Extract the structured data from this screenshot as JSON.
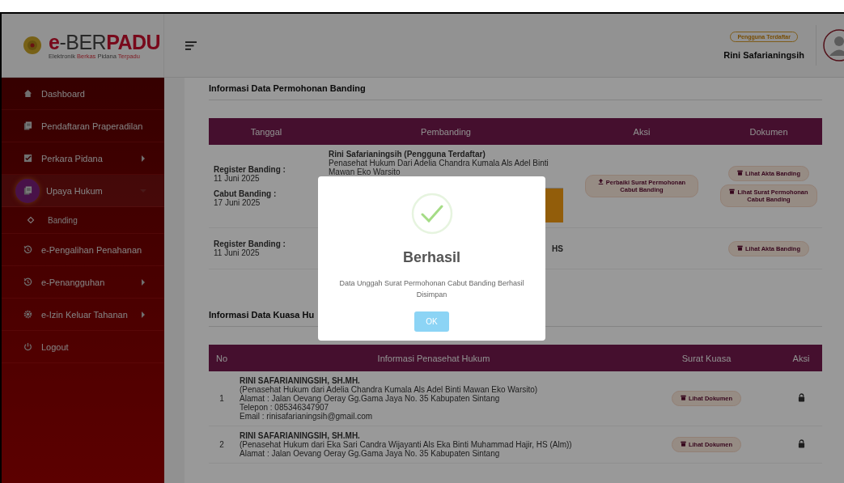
{
  "logo": {
    "title": [
      {
        "text": "e",
        "kind": "accent"
      },
      {
        "text": "-BER",
        "kind": "plain"
      },
      {
        "text": "PADU",
        "kind": "accent"
      }
    ],
    "subtitle": [
      {
        "text": "Elektronik ",
        "kind": "plain"
      },
      {
        "text": "Berkas",
        "kind": "accent"
      },
      {
        "text": " Pidana ",
        "kind": "plain"
      },
      {
        "text": "Terpadu",
        "kind": "accent"
      }
    ]
  },
  "user": {
    "badge": "Pengguna Terdaftar",
    "name": "Rini Safarianingsih"
  },
  "sidebar": {
    "items": [
      {
        "label": "Dashboard",
        "kind": "home",
        "submenu": false,
        "selected": false
      },
      {
        "label": "Pendaftaran Praperadilan",
        "kind": "docs",
        "submenu": false,
        "selected": false
      },
      {
        "label": "Perkara Pidana",
        "kind": "check",
        "submenu": true,
        "expanded": false,
        "selected": false
      },
      {
        "label": "Upaya Hukum",
        "kind": "docs",
        "submenu": true,
        "expanded": true,
        "selected": true,
        "children": [
          {
            "label": "Banding",
            "selected": false
          }
        ]
      },
      {
        "label": "e-Pengalihan Penahanan",
        "kind": "history",
        "submenu": false,
        "selected": false
      },
      {
        "label": "e-Penangguhan",
        "kind": "history",
        "submenu": true,
        "expanded": false,
        "selected": false
      },
      {
        "label": "e-Izin Keluar Tahanan",
        "kind": "gear",
        "submenu": true,
        "expanded": false,
        "selected": false
      },
      {
        "label": "Logout",
        "kind": "power",
        "submenu": false,
        "selected": false
      }
    ]
  },
  "banding": {
    "title": "Informasi Data Permohonan Banding",
    "columns": [
      "Tanggal",
      "Pembanding",
      "Aksi",
      "Dokumen"
    ],
    "rows": [
      {
        "dates": [
          {
            "label": "Register Banding :",
            "value": "11 Juni 2025"
          },
          {
            "label": "Cabut Banding :",
            "value": "17 Juni 2025"
          }
        ],
        "name": "Rini Safarianingsih (Pengguna Terdaftar)",
        "description": "Penasehat Hukum Dari Adelia Chandra Kumala Als Adel Binti Mawan Eko Warsito",
        "notice": true,
        "actions": [
          "Perbaiki Surat Permohonan Cabut Banding"
        ],
        "documents": [
          "Lihat Akta Banding",
          "Lihat Surat Permohonan Cabut Banding"
        ]
      },
      {
        "dates": [
          {
            "label": "Register Banding :",
            "value": "11 Juni 2025"
          }
        ],
        "name": "HS",
        "notice": false,
        "actions": [],
        "documents": [
          "Lihat Akta Banding"
        ]
      }
    ]
  },
  "kuasa": {
    "title": "Informasi Data Kuasa Hu",
    "columns": [
      "No",
      "Informasi Penasehat Hukum",
      "Surat Kuasa",
      "Aksi"
    ],
    "rows": [
      {
        "no": "1",
        "name": "RINI SAFARIANINGSIH, SH.MH.",
        "lines": [
          "(Penasehat Hukum dari Adelia Chandra Kumala Als Adel Binti Mawan Eko Warsito)",
          "Alamat : Jalan Oevang Oeray Gg.Gama Jaya No. 35 Kabupaten Sintang",
          "Telepon : 085346347907",
          "Email : rinisafarianingsih@gmail.com"
        ],
        "document": "Lihat Dokumen"
      },
      {
        "no": "2",
        "name": "RINI SAFARIANINGSIH, SH.MH.",
        "lines": [
          "(Penasehat Hukum dari Eka Sari Candra Wijayanti Als Eka Binti Muhammad Hajir, HS (Alm))",
          "Alamat : Jalan Oevang Oeray Gg.Gama Jaya No. 35 Kabupaten Sintang"
        ],
        "document": "Lihat Dokumen"
      }
    ]
  },
  "dialog": {
    "title": "Berhasil",
    "message": "Data Unggah Surat Permohonan Cabut Banding Berhasil Disimpan",
    "button": "OK"
  }
}
